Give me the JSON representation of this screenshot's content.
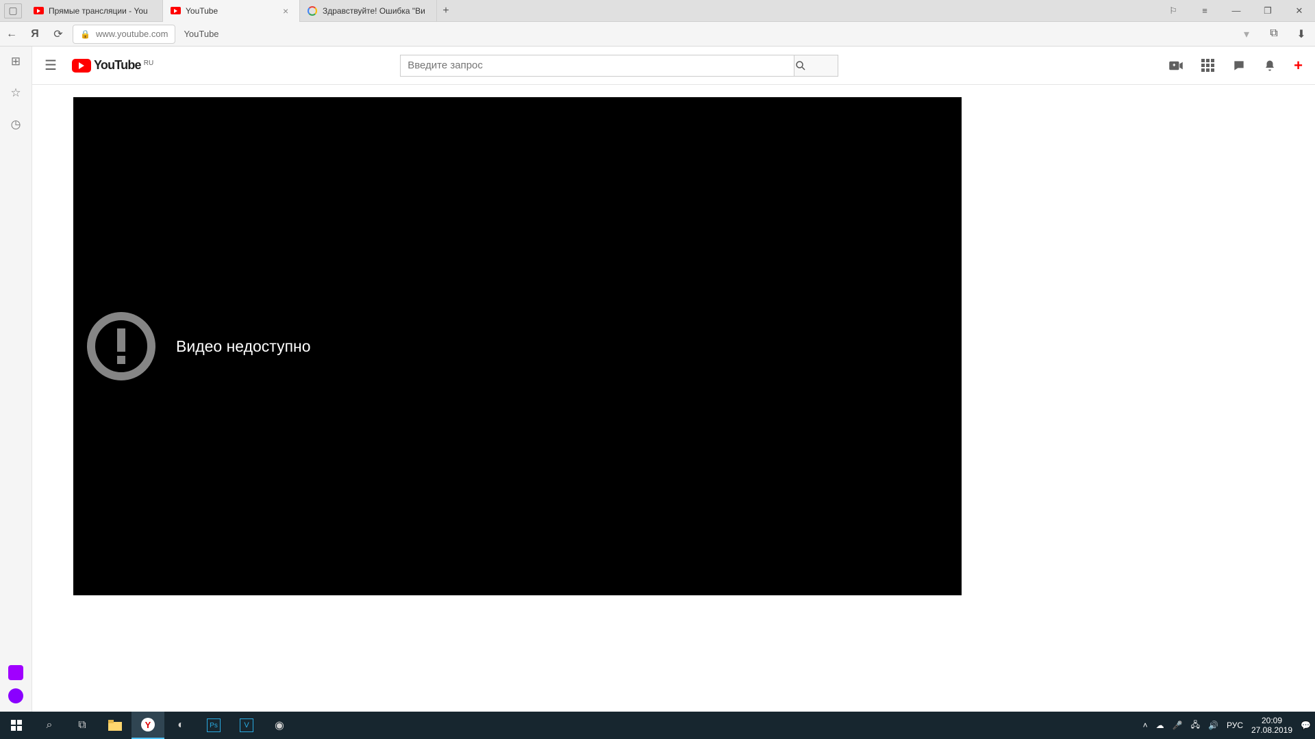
{
  "browser_tabs": [
    {
      "title": "Прямые трансляции - You",
      "icon": "youtube"
    },
    {
      "title": "YouTube",
      "icon": "youtube",
      "active": true
    },
    {
      "title": "Здравствуйте! Ошибка \"Ви",
      "icon": "google"
    }
  ],
  "address_bar": {
    "domain": "www.youtube.com",
    "page_label": "YouTube",
    "yandex_letter": "Я"
  },
  "youtube": {
    "logo_text": "YouTube",
    "logo_region": "RU",
    "search_placeholder": "Введите запрос",
    "player_error": "Видео недоступно"
  },
  "taskbar": {
    "lang": "РУС",
    "time": "20:09",
    "date": "27.08.2019"
  }
}
